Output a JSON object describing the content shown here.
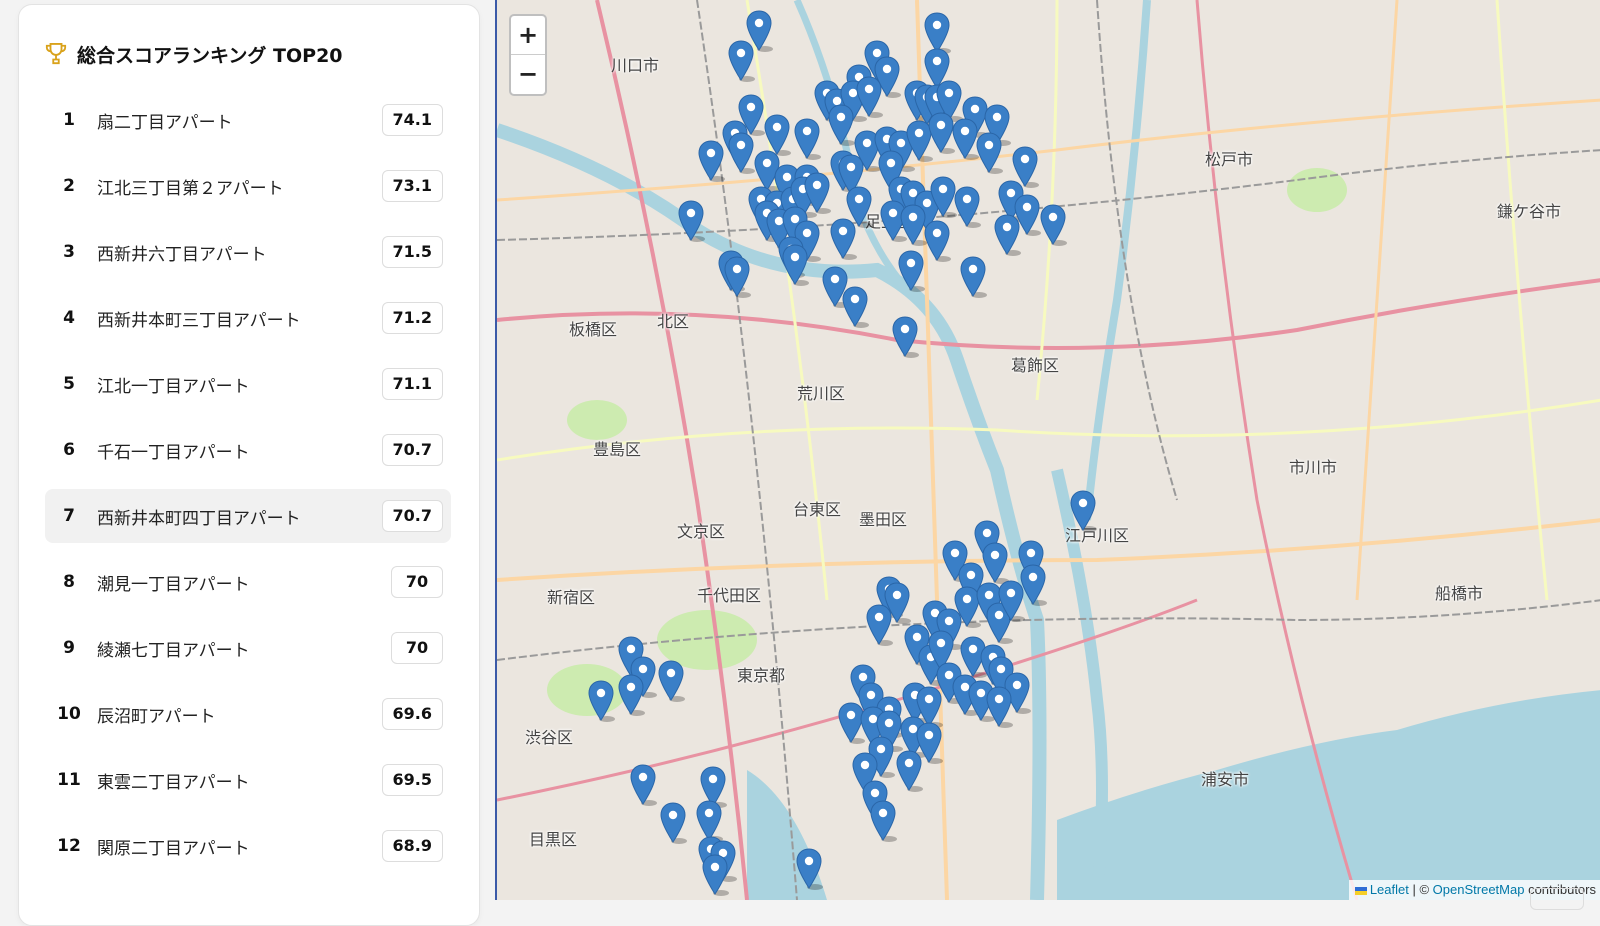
{
  "panel": {
    "title": "総合スコアランキング TOP20",
    "trophy_icon": "trophy-icon",
    "items": [
      {
        "rank": "1",
        "name": "扇二丁目アパート",
        "score": "74.1"
      },
      {
        "rank": "2",
        "name": "江北三丁目第２アパート",
        "score": "73.1"
      },
      {
        "rank": "3",
        "name": "西新井六丁目アパート",
        "score": "71.5"
      },
      {
        "rank": "4",
        "name": "西新井本町三丁目アパート",
        "score": "71.2"
      },
      {
        "rank": "5",
        "name": "江北一丁目アパート",
        "score": "71.1"
      },
      {
        "rank": "6",
        "name": "千石一丁目アパート",
        "score": "70.7"
      },
      {
        "rank": "7",
        "name": "西新井本町四丁目アパート",
        "score": "70.7"
      },
      {
        "rank": "8",
        "name": "潮見一丁目アパート",
        "score": "70"
      },
      {
        "rank": "9",
        "name": "綾瀬七丁目アパート",
        "score": "70"
      },
      {
        "rank": "10",
        "name": "辰沼町アパート",
        "score": "69.6"
      },
      {
        "rank": "11",
        "name": "東雲二丁目アパート",
        "score": "69.5"
      },
      {
        "rank": "12",
        "name": "関原二丁目アパート",
        "score": "68.9"
      }
    ],
    "highlighted_rank": "7"
  },
  "map": {
    "zoom_in_label": "+",
    "zoom_out_label": "−",
    "place_labels": [
      "川口市",
      "松戸市",
      "鎌ケ谷市",
      "板橋区",
      "北区",
      "葛飾区",
      "荒川区",
      "豊島区",
      "市川市",
      "台東区",
      "墨田区",
      "文京区",
      "江戸川区",
      "新宿区",
      "千代田区",
      "船橋市",
      "東京都",
      "渋谷区",
      "浦安市",
      "目黒区",
      "足立区"
    ],
    "attribution": {
      "leaflet": "Leaflet",
      "separator": " | © ",
      "osm": "OpenStreetMap",
      "suffix": " contributors"
    },
    "colors": {
      "marker": "#3a7fc7",
      "marker_dark": "#2a66a8",
      "water": "#aad3df",
      "park": "#cdebb0"
    }
  }
}
